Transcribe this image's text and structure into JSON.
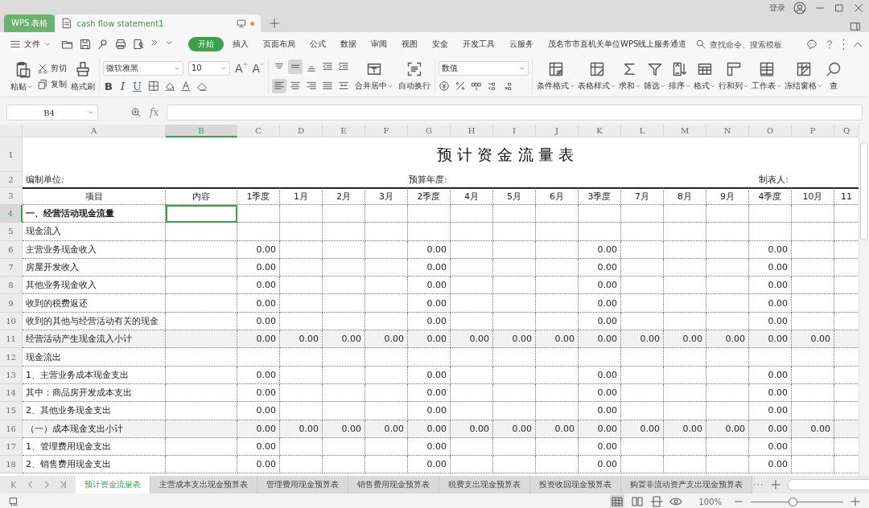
{
  "titlebar": {
    "app_tab": "WPS 表格",
    "doc_tab": {
      "title": "cash flow statement1",
      "unsaved": true
    },
    "login": "登录"
  },
  "menu": {
    "file": "文件",
    "tabs": [
      {
        "label": "开始",
        "selected": true
      },
      {
        "label": "插入",
        "selected": false
      },
      {
        "label": "页面布局",
        "selected": false
      },
      {
        "label": "公式",
        "selected": false
      },
      {
        "label": "数据",
        "selected": false
      },
      {
        "label": "审阅",
        "selected": false
      },
      {
        "label": "视图",
        "selected": false
      },
      {
        "label": "安全",
        "selected": false
      },
      {
        "label": "开发工具",
        "selected": false
      },
      {
        "label": "云服务",
        "selected": false
      },
      {
        "label": "茂名市市直机关单位WPS线上服务通道",
        "selected": false
      }
    ],
    "search": {
      "placeholder": "查找命令、搜索模板"
    }
  },
  "ribbon": {
    "paste": "粘贴",
    "cut": "剪切",
    "copy": "复制",
    "format_painter": "格式刷",
    "font_name": "微软雅黑",
    "font_size": "10",
    "font_grow": "A",
    "font_shrink": "A",
    "style_buttons": [
      "B",
      "I",
      "U"
    ],
    "alignment": [
      {
        "selected": false
      },
      {
        "selected": true
      },
      {
        "selected": false
      },
      {
        "selected": false
      },
      {
        "selected": false
      },
      {
        "selected": true
      },
      {
        "selected": false
      },
      {
        "selected": false
      },
      {
        "selected": false
      },
      {
        "selected": false
      }
    ],
    "merge": "合并居中",
    "wrap": "自动换行",
    "number_format": "数值",
    "tools": [
      "条件格式",
      "表格样式",
      "求和",
      "筛选",
      "排序",
      "格式",
      "行和列",
      "工作表",
      "冻结窗格",
      "查"
    ]
  },
  "formula_bar": {
    "name_box": "B4",
    "fx": "fx"
  },
  "sheet": {
    "columns": [
      {
        "letter": "A",
        "selected": false
      },
      {
        "letter": "B",
        "selected": true
      },
      {
        "letter": "C",
        "selected": false
      },
      {
        "letter": "D",
        "selected": false
      },
      {
        "letter": "E",
        "selected": false
      },
      {
        "letter": "F",
        "selected": false
      },
      {
        "letter": "G",
        "selected": false
      },
      {
        "letter": "H",
        "selected": false
      },
      {
        "letter": "I",
        "selected": false
      },
      {
        "letter": "J",
        "selected": false
      },
      {
        "letter": "K",
        "selected": false
      },
      {
        "letter": "L",
        "selected": false
      },
      {
        "letter": "M",
        "selected": false
      },
      {
        "letter": "N",
        "selected": false
      },
      {
        "letter": "O",
        "selected": false
      },
      {
        "letter": "P",
        "selected": false
      },
      {
        "letter": "Q",
        "selected": false
      }
    ],
    "rows": [
      {
        "number": "1",
        "kind": "title",
        "selected": false,
        "cells": {
          "A": "预 计 资 金 流 量 表"
        }
      },
      {
        "number": "2",
        "kind": "info",
        "selected": false,
        "cells": {
          "A": "编制单位:",
          "G": "预算年度:",
          "O": "制表人:"
        }
      },
      {
        "number": "3",
        "kind": "header",
        "selected": false,
        "cells": {
          "A": "项目",
          "B": "内容",
          "C": "1季度",
          "D": "1月",
          "E": "2月",
          "F": "3月",
          "G": "2季度",
          "H": "4月",
          "I": "5月",
          "J": "6月",
          "K": "3季度",
          "L": "7月",
          "M": "8月",
          "N": "9月",
          "O": "4季度",
          "P": "10月",
          "Q": "11"
        }
      },
      {
        "number": "4",
        "kind": "section",
        "selected": true,
        "cells": {
          "A": "一、经营活动现金流量"
        }
      },
      {
        "number": "5",
        "kind": "item",
        "selected": false,
        "cells": {
          "A": "现金流入"
        }
      },
      {
        "number": "6",
        "kind": "item",
        "selected": false,
        "cells": {
          "A": "主营业务现金收入",
          "C": "0.00",
          "G": "0.00",
          "K": "0.00",
          "O": "0.00"
        }
      },
      {
        "number": "7",
        "kind": "item",
        "selected": false,
        "cells": {
          "A": "房屋开发收入",
          "C": "0.00",
          "G": "0.00",
          "K": "0.00",
          "O": "0.00"
        }
      },
      {
        "number": "8",
        "kind": "item",
        "selected": false,
        "cells": {
          "A": "其他业务现金收入",
          "C": "0.00",
          "G": "0.00",
          "K": "0.00",
          "O": "0.00"
        }
      },
      {
        "number": "9",
        "kind": "item",
        "selected": false,
        "cells": {
          "A": "收到的税费返还",
          "C": "0.00",
          "G": "0.00",
          "K": "0.00",
          "O": "0.00"
        }
      },
      {
        "number": "10",
        "kind": "item",
        "selected": false,
        "cells": {
          "A": "收到的其他与经营活动有关的现金",
          "C": "0.00",
          "G": "0.00",
          "K": "0.00",
          "O": "0.00"
        }
      },
      {
        "number": "11",
        "kind": "subtotal",
        "selected": false,
        "cells": {
          "A": "经营活动产生现金流入小计",
          "C": "0.00",
          "D": "0.00",
          "E": "0.00",
          "F": "0.00",
          "G": "0.00",
          "H": "0.00",
          "I": "0.00",
          "J": "0.00",
          "K": "0.00",
          "L": "0.00",
          "M": "0.00",
          "N": "0.00",
          "O": "0.00",
          "P": "0.00"
        }
      },
      {
        "number": "12",
        "kind": "item",
        "selected": false,
        "cells": {
          "A": "现金流出"
        }
      },
      {
        "number": "13",
        "kind": "item",
        "selected": false,
        "cells": {
          "A": "1、主营业务成本现金支出",
          "C": "0.00",
          "G": "0.00",
          "K": "0.00",
          "O": "0.00"
        }
      },
      {
        "number": "14",
        "kind": "item",
        "selected": false,
        "cells": {
          "A": "其中：商品房开发成本支出",
          "C": "0.00",
          "G": "0.00",
          "K": "0.00",
          "O": "0.00"
        }
      },
      {
        "number": "15",
        "kind": "item",
        "selected": false,
        "cells": {
          "A": "2、其他业务现金支出",
          "C": "0.00",
          "G": "0.00",
          "K": "0.00",
          "O": "0.00"
        }
      },
      {
        "number": "16",
        "kind": "subtotal",
        "selected": false,
        "cells": {
          "A": "（一）成本现金支出小计",
          "C": "0.00",
          "D": "0.00",
          "E": "0.00",
          "F": "0.00",
          "G": "0.00",
          "H": "0.00",
          "I": "0.00",
          "J": "0.00",
          "K": "0.00",
          "L": "0.00",
          "M": "0.00",
          "N": "0.00",
          "O": "0.00",
          "P": "0.00"
        }
      },
      {
        "number": "17",
        "kind": "item",
        "selected": false,
        "cells": {
          "A": "1、管理费用现金支出",
          "C": "0.00",
          "G": "0.00",
          "K": "0.00",
          "O": "0.00"
        }
      },
      {
        "number": "18",
        "kind": "item",
        "selected": false,
        "cells": {
          "A": "2、销售费用现金支出",
          "C": "0.00",
          "G": "0.00",
          "K": "0.00",
          "O": "0.00"
        }
      }
    ]
  },
  "sheet_tabs": [
    {
      "label": "预计资金流量表",
      "selected": true
    },
    {
      "label": "主营成本支出现金预算表",
      "selected": false
    },
    {
      "label": "管理费用现金预算表",
      "selected": false
    },
    {
      "label": "销售费用现金预算表",
      "selected": false
    },
    {
      "label": "税费支出现金预算表",
      "selected": false
    },
    {
      "label": "投资收回现金预算表",
      "selected": false
    },
    {
      "label": "购置非流动资产支出现金预算表",
      "selected": false
    }
  ],
  "status_bar": {
    "zoom": "100%",
    "zoom_slider": {
      "level": 0.45
    }
  }
}
